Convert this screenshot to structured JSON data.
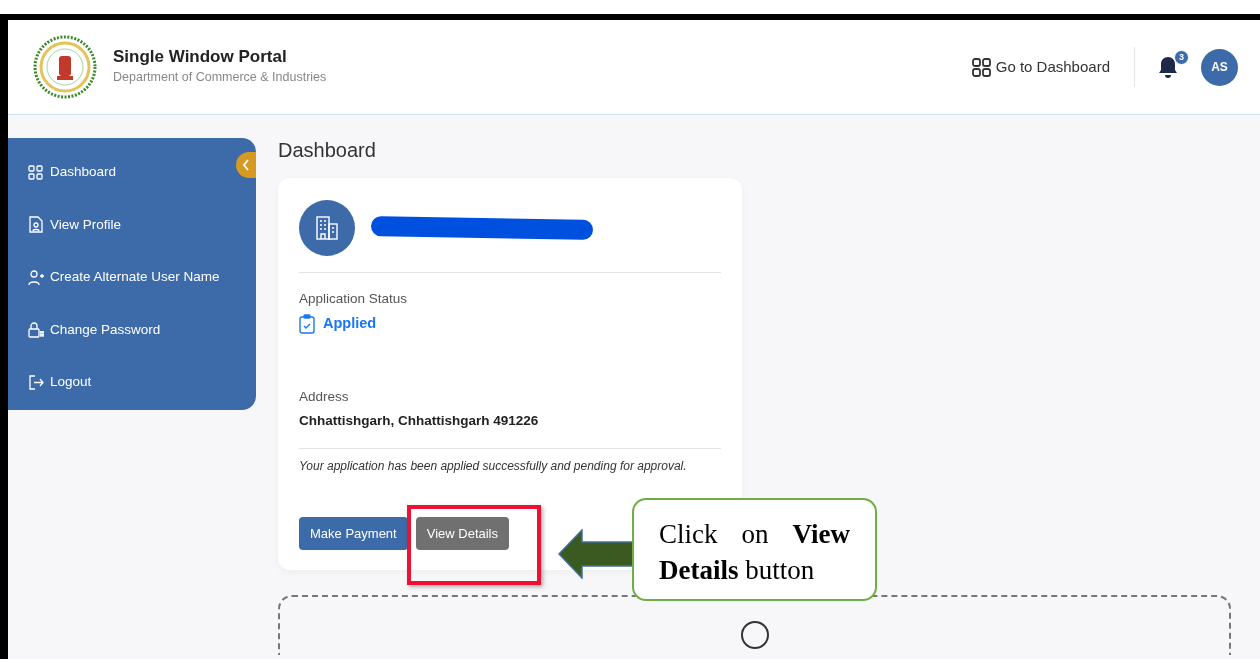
{
  "header": {
    "title": "Single Window Portal",
    "subtitle": "Department of Commerce & Industries",
    "dashboard_link": "Go to Dashboard",
    "notification_count": "3",
    "avatar_initials": "AS"
  },
  "sidebar": {
    "items": [
      {
        "label": "Dashboard"
      },
      {
        "label": "View Profile"
      },
      {
        "label": "Create Alternate User Name"
      },
      {
        "label": "Change Password"
      },
      {
        "label": "Logout"
      }
    ]
  },
  "page_title": "Dashboard",
  "card": {
    "status_label": "Application Status",
    "status": "Applied",
    "address_label": "Address",
    "address": "Chhattishgarh, Chhattishgarh 491226",
    "message": "Your application has been applied successfully and pending for approval.",
    "buttons": [
      {
        "label": "Make Payment",
        "kind": "primary"
      },
      {
        "label": "View Details",
        "kind": "secondary"
      }
    ]
  },
  "annotation": {
    "callout": "Click on **View Details** button"
  }
}
